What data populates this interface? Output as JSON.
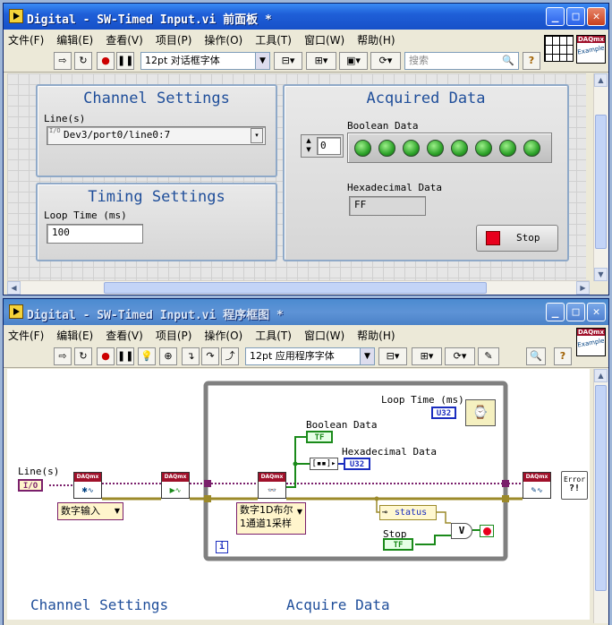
{
  "front": {
    "title": "Digital - SW-Timed Input.vi 前面板 *",
    "menu": [
      "文件(F)",
      "编辑(E)",
      "查看(V)",
      "项目(P)",
      "操作(O)",
      "工具(T)",
      "窗口(W)",
      "帮助(H)"
    ],
    "font_label": "12pt 对话框字体",
    "search_placeholder": "搜索",
    "search_icon": "magnifier-icon",
    "channel_settings": {
      "title": "Channel Settings",
      "line_label": "Line(s)",
      "line_value": "Dev3/port0/line0:7",
      "io_prefix": "I/O"
    },
    "timing_settings": {
      "title": "Timing Settings",
      "loop_label": "Loop Time (ms)",
      "loop_value": "100"
    },
    "acquired_data": {
      "title": "Acquired Data",
      "bool_label": "Boolean Data",
      "index_value": "0",
      "led_count": 8,
      "hex_label": "Hexadecimal Data",
      "hex_value": "FF",
      "stop_label": "Stop",
      "stop_color": "#e8001c"
    },
    "badge": {
      "top": "DAQmx",
      "bottom": "Example"
    }
  },
  "block": {
    "title": "Digital - SW-Timed Input.vi 程序框图 *",
    "menu": [
      "文件(F)",
      "编辑(E)",
      "查看(V)",
      "项目(P)",
      "操作(O)",
      "工具(T)",
      "窗口(W)",
      "帮助(H)"
    ],
    "font_label": "12pt 应用程序字体",
    "badge": {
      "top": "DAQmx",
      "bottom": "Example"
    },
    "lines_label": "Line(s)",
    "io_const": "I/O",
    "create_poly": "数字输入",
    "read_poly_line1": "数字1D布尔",
    "read_poly_line2": "1通道1采样",
    "loop_time_label": "Loop Time (ms)",
    "u32": "U32",
    "bool_label": "Boolean Data",
    "tf": "TF",
    "hex_label": "Hexadecimal Data",
    "status": "status",
    "stop_label": "Stop",
    "or_symbol": "V",
    "iteration": "i",
    "error_text_1": "Error",
    "error_text_2": "?!",
    "footer_left": "Channel Settings",
    "footer_right": "Acquire Data",
    "colors": {
      "wire_daq": "#7a1f6b",
      "wire_error": "#9c8a2a",
      "wire_bool": "#1a8a1a",
      "wire_u32": "#1b2dbf",
      "loop_border": "#808080"
    }
  }
}
